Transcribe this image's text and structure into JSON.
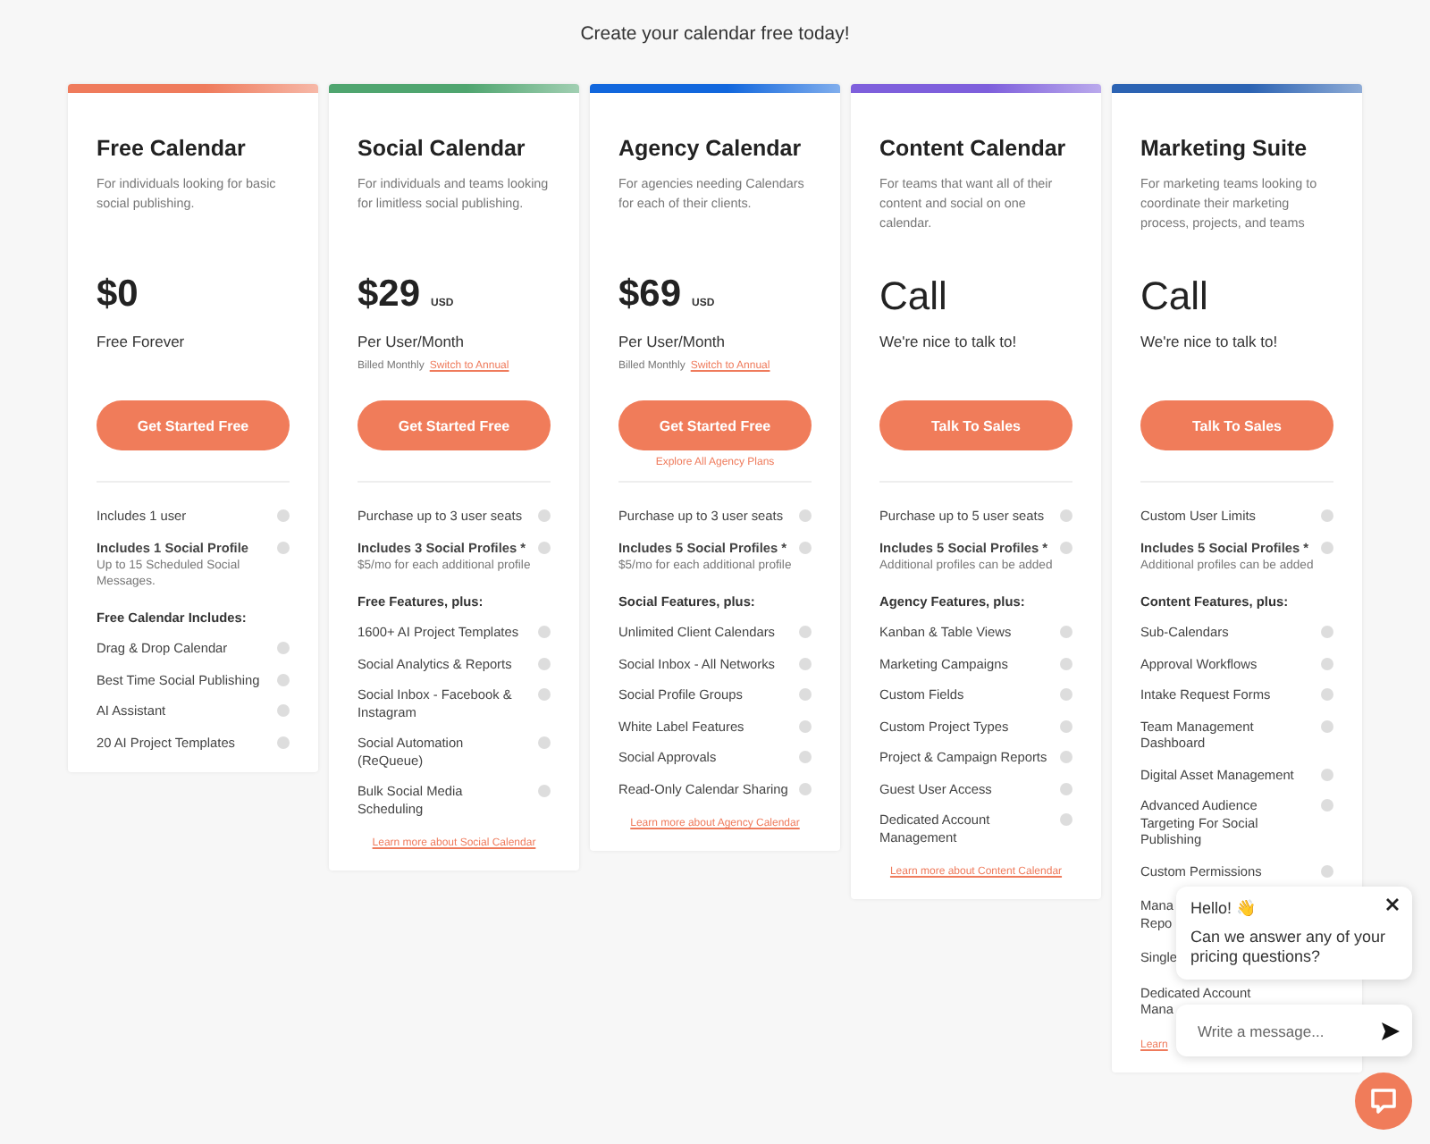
{
  "subtitle": "Create your calendar free today!",
  "plans": [
    {
      "title": "Free Calendar",
      "color": "#ef7b5c",
      "description": "For individuals looking for basic social publishing.",
      "price": "$0",
      "kind": "amount",
      "period": "Free Forever",
      "button": "Get Started Free",
      "features": [
        {
          "kind": "feature",
          "text": "Includes 1 user"
        },
        {
          "kind": "profile",
          "text": "Includes 1 Social Profile",
          "note": "Up to 15 Scheduled Social Messages."
        },
        {
          "kind": "heading",
          "text": "Free Calendar Includes:"
        },
        {
          "kind": "feature",
          "text": "Drag & Drop Calendar"
        },
        {
          "kind": "feature",
          "text": "Best Time Social Publishing"
        },
        {
          "kind": "feature",
          "text": "AI Assistant"
        },
        {
          "kind": "feature",
          "text": "20 AI Project Templates"
        }
      ]
    },
    {
      "title": "Social Calendar",
      "color": "#4fa56f",
      "description": "For individuals and teams looking for limitless social publishing.",
      "price": "$29",
      "unit": "USD",
      "kind": "amount",
      "period": "Per User/Month",
      "billing": "Billed Monthly",
      "billing_link": "Switch to Annual",
      "button": "Get Started Free",
      "features": [
        {
          "kind": "feature",
          "text": "Purchase up to 3 user seats"
        },
        {
          "kind": "profile",
          "text": "Includes 3 Social Profiles *",
          "note": "$5/mo for each additional profile"
        },
        {
          "kind": "heading",
          "text": "Free Features, plus:"
        },
        {
          "kind": "feature",
          "text": "1600+ AI Project Templates"
        },
        {
          "kind": "feature",
          "text": "Social Analytics & Reports"
        },
        {
          "kind": "feature",
          "text": "Social Inbox - Facebook & Instagram"
        },
        {
          "kind": "feature",
          "text": "Social Automation (ReQueue)"
        },
        {
          "kind": "feature",
          "text": "Bulk Social Media Scheduling"
        }
      ],
      "learn_more": "Learn more about Social Calendar"
    },
    {
      "title": "Agency Calendar",
      "color": "#1267dd",
      "description": "For agencies needing Calendars for each of their clients.",
      "price": "$69",
      "unit": "USD",
      "kind": "amount",
      "period": "Per User/Month",
      "billing": "Billed Monthly",
      "billing_link": "Switch to Annual",
      "button": "Get Started Free",
      "explore": "Explore All Agency Plans",
      "features": [
        {
          "kind": "feature",
          "text": "Purchase up to 3 user seats"
        },
        {
          "kind": "profile",
          "text": "Includes 5 Social Profiles *",
          "note": "$5/mo for each additional profile"
        },
        {
          "kind": "heading",
          "text": "Social Features, plus:"
        },
        {
          "kind": "feature",
          "text": "Unlimited Client Calendars"
        },
        {
          "kind": "feature",
          "text": "Social Inbox - All Networks"
        },
        {
          "kind": "feature",
          "text": "Social Profile Groups"
        },
        {
          "kind": "feature",
          "text": "White Label Features"
        },
        {
          "kind": "feature",
          "text": "Social Approvals"
        },
        {
          "kind": "feature",
          "text": "Read-Only Calendar Sharing"
        }
      ],
      "learn_more": "Learn more about Agency Calendar"
    },
    {
      "title": "Content Calendar",
      "color": "#7e5fdc",
      "description": "For teams that want all of their content and social on one calendar.",
      "price": "Call",
      "kind": "call",
      "period": "We're nice to talk to!",
      "button": "Talk To Sales",
      "features": [
        {
          "kind": "feature",
          "text": "Purchase up to 5 user seats"
        },
        {
          "kind": "profile",
          "text": "Includes 5 Social Profiles *",
          "note": "Additional profiles can be added"
        },
        {
          "kind": "heading",
          "text": "Agency Features, plus:"
        },
        {
          "kind": "feature",
          "text": "Kanban & Table Views"
        },
        {
          "kind": "feature",
          "text": "Marketing Campaigns"
        },
        {
          "kind": "feature",
          "text": "Custom Fields"
        },
        {
          "kind": "feature",
          "text": "Custom Project Types"
        },
        {
          "kind": "feature",
          "text": "Project & Campaign Reports"
        },
        {
          "kind": "feature",
          "text": "Guest User Access"
        },
        {
          "kind": "feature",
          "text": "Dedicated Account Management"
        }
      ],
      "learn_more": "Learn more about Content Calendar"
    },
    {
      "title": "Marketing Suite",
      "color": "#2c63b3",
      "description": "For marketing teams looking to coordinate their marketing process, projects, and teams",
      "price": "Call",
      "kind": "call",
      "period": "We're nice to talk to!",
      "button": "Talk To Sales",
      "features": [
        {
          "kind": "feature",
          "text": "Custom User Limits"
        },
        {
          "kind": "profile",
          "text": "Includes 5 Social Profiles *",
          "note": "Additional profiles can be added"
        },
        {
          "kind": "heading",
          "text": "Content Features, plus:"
        },
        {
          "kind": "feature",
          "text": "Sub-Calendars"
        },
        {
          "kind": "feature",
          "text": "Approval Workflows"
        },
        {
          "kind": "feature",
          "text": "Intake Request Forms"
        },
        {
          "kind": "feature",
          "text": "Team Management Dashboard"
        },
        {
          "kind": "feature",
          "text": "Digital Asset Management"
        },
        {
          "kind": "feature",
          "text": "Advanced Audience Targeting For Social Publishing"
        },
        {
          "kind": "feature",
          "text": "Custom Permissions"
        },
        {
          "kind": "cut",
          "text": "Mana\nRepo"
        },
        {
          "kind": "cut",
          "text": "Single"
        },
        {
          "kind": "cut",
          "text": "Dedicated Account\nMana"
        }
      ],
      "learn_more": "Learn"
    }
  ],
  "chat": {
    "greeting": "Hello! 👋",
    "question": "Can we answer any of your pricing questions?",
    "placeholder": "Write a message..."
  }
}
